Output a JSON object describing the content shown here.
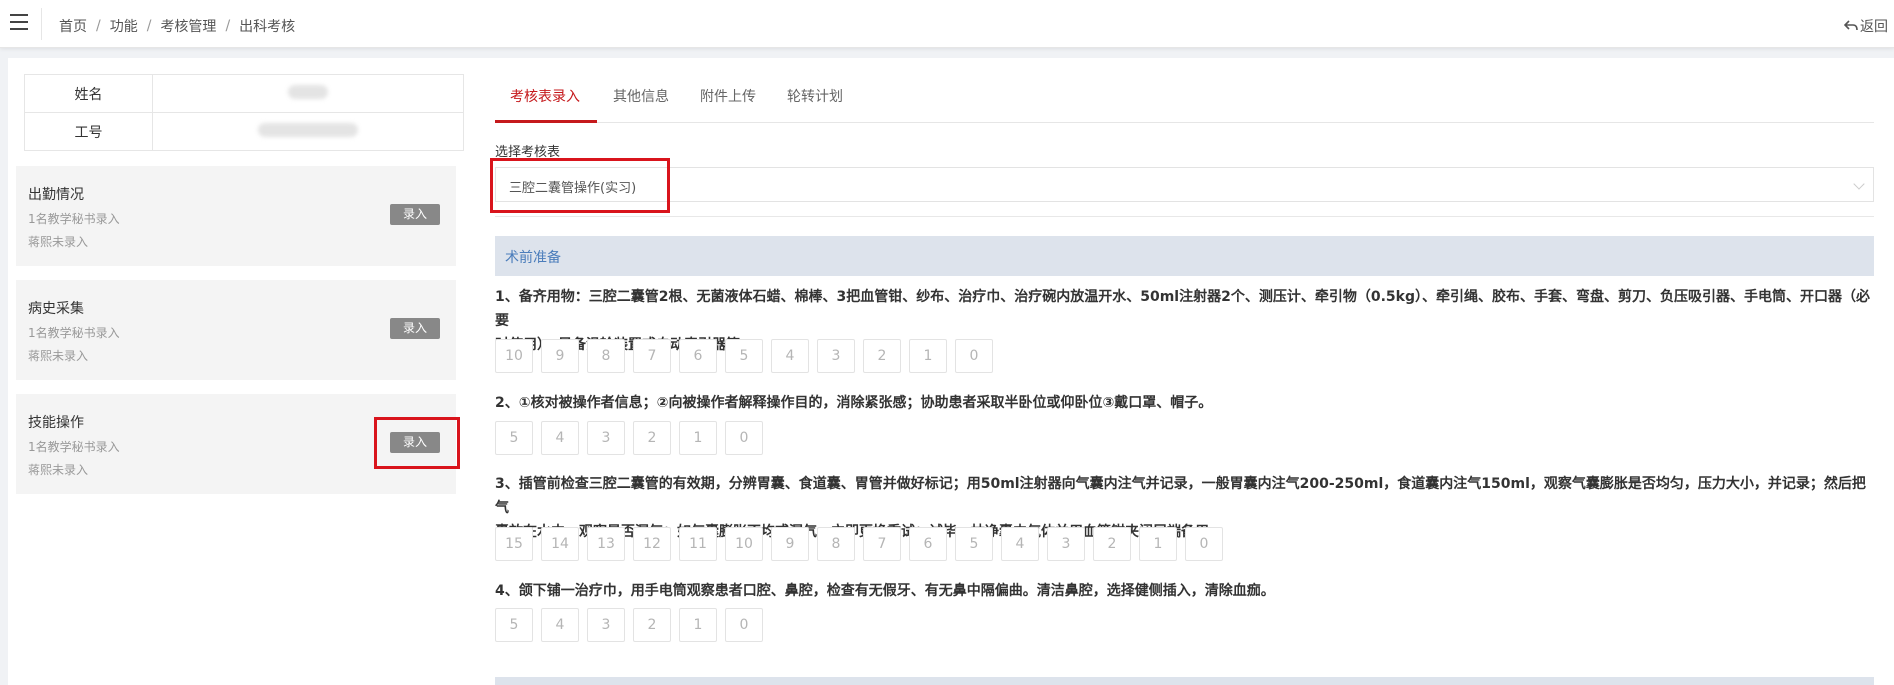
{
  "header": {
    "breadcrumb": [
      "首页",
      "功能",
      "考核管理",
      "出科考核"
    ],
    "back_label": "返回"
  },
  "info": {
    "name_label": "姓名",
    "id_label": "工号"
  },
  "cards": [
    {
      "title": "出勤情况",
      "line1": "1名教学秘书录入",
      "line2": "蒋熙未录入",
      "button": "录入"
    },
    {
      "title": "病史采集",
      "line1": "1名教学秘书录入",
      "line2": "蒋熙未录入",
      "button": "录入"
    },
    {
      "title": "技能操作",
      "line1": "1名教学秘书录入",
      "line2": "蒋熙未录入",
      "button": "录入"
    }
  ],
  "tabs": [
    "考核表录入",
    "其他信息",
    "附件上传",
    "轮转计划"
  ],
  "form": {
    "select_label": "选择考核表",
    "select_value": "三腔二囊管操作(实习)"
  },
  "section_title": "术前准备",
  "items": [
    {
      "line1": "1、备齐用物：三腔二囊管2根、无菌液体石蜡、棉棒、3把血管钳、纱布、治疗巾、治疗碗内放温开水、50ml注射器2个、测压计、牵引物（0.5kg）、牵引绳、胶布、手套、弯盘、剪刀、负压吸引器、手电筒、开口器（必要",
      "line2": "时使用），另备滑轮装置或自动牵引器等。",
      "scores": [
        "10",
        "9",
        "8",
        "7",
        "6",
        "5",
        "4",
        "3",
        "2",
        "1",
        "0"
      ]
    },
    {
      "line1": "2、①核对被操作者信息；②向被操作者解释操作目的，消除紧张感；协助患者采取半卧位或仰卧位③戴口罩、帽子。",
      "line2": "",
      "scores": [
        "5",
        "4",
        "3",
        "2",
        "1",
        "0"
      ]
    },
    {
      "line1": "3、插管前检查三腔二囊管的有效期，分辨胃囊、食道囊、胃管并做好标记；用50ml注射器向气囊内注气并记录，一般胃囊内注气200-250ml，食道囊内注气150ml，观察气囊膨胀是否均匀，压力大小，并记录；然后把气",
      "line2": "囊放在水中，观察是否漏气；如气囊膨胀不均或漏气，立即更换重试；试毕，抽净囊内气体并用血管钳夹闭尾端备用。",
      "scores": [
        "15",
        "14",
        "13",
        "12",
        "11",
        "10",
        "9",
        "8",
        "7",
        "6",
        "5",
        "4",
        "3",
        "2",
        "1",
        "0"
      ]
    },
    {
      "line1": "4、颌下铺一治疗巾，用手电筒观察患者口腔、鼻腔，检查有无假牙、有无鼻中隔偏曲。清洁鼻腔，选择健侧插入，清除血痂。",
      "line2": "",
      "scores": [
        "5",
        "4",
        "3",
        "2",
        "1",
        "0"
      ]
    }
  ]
}
